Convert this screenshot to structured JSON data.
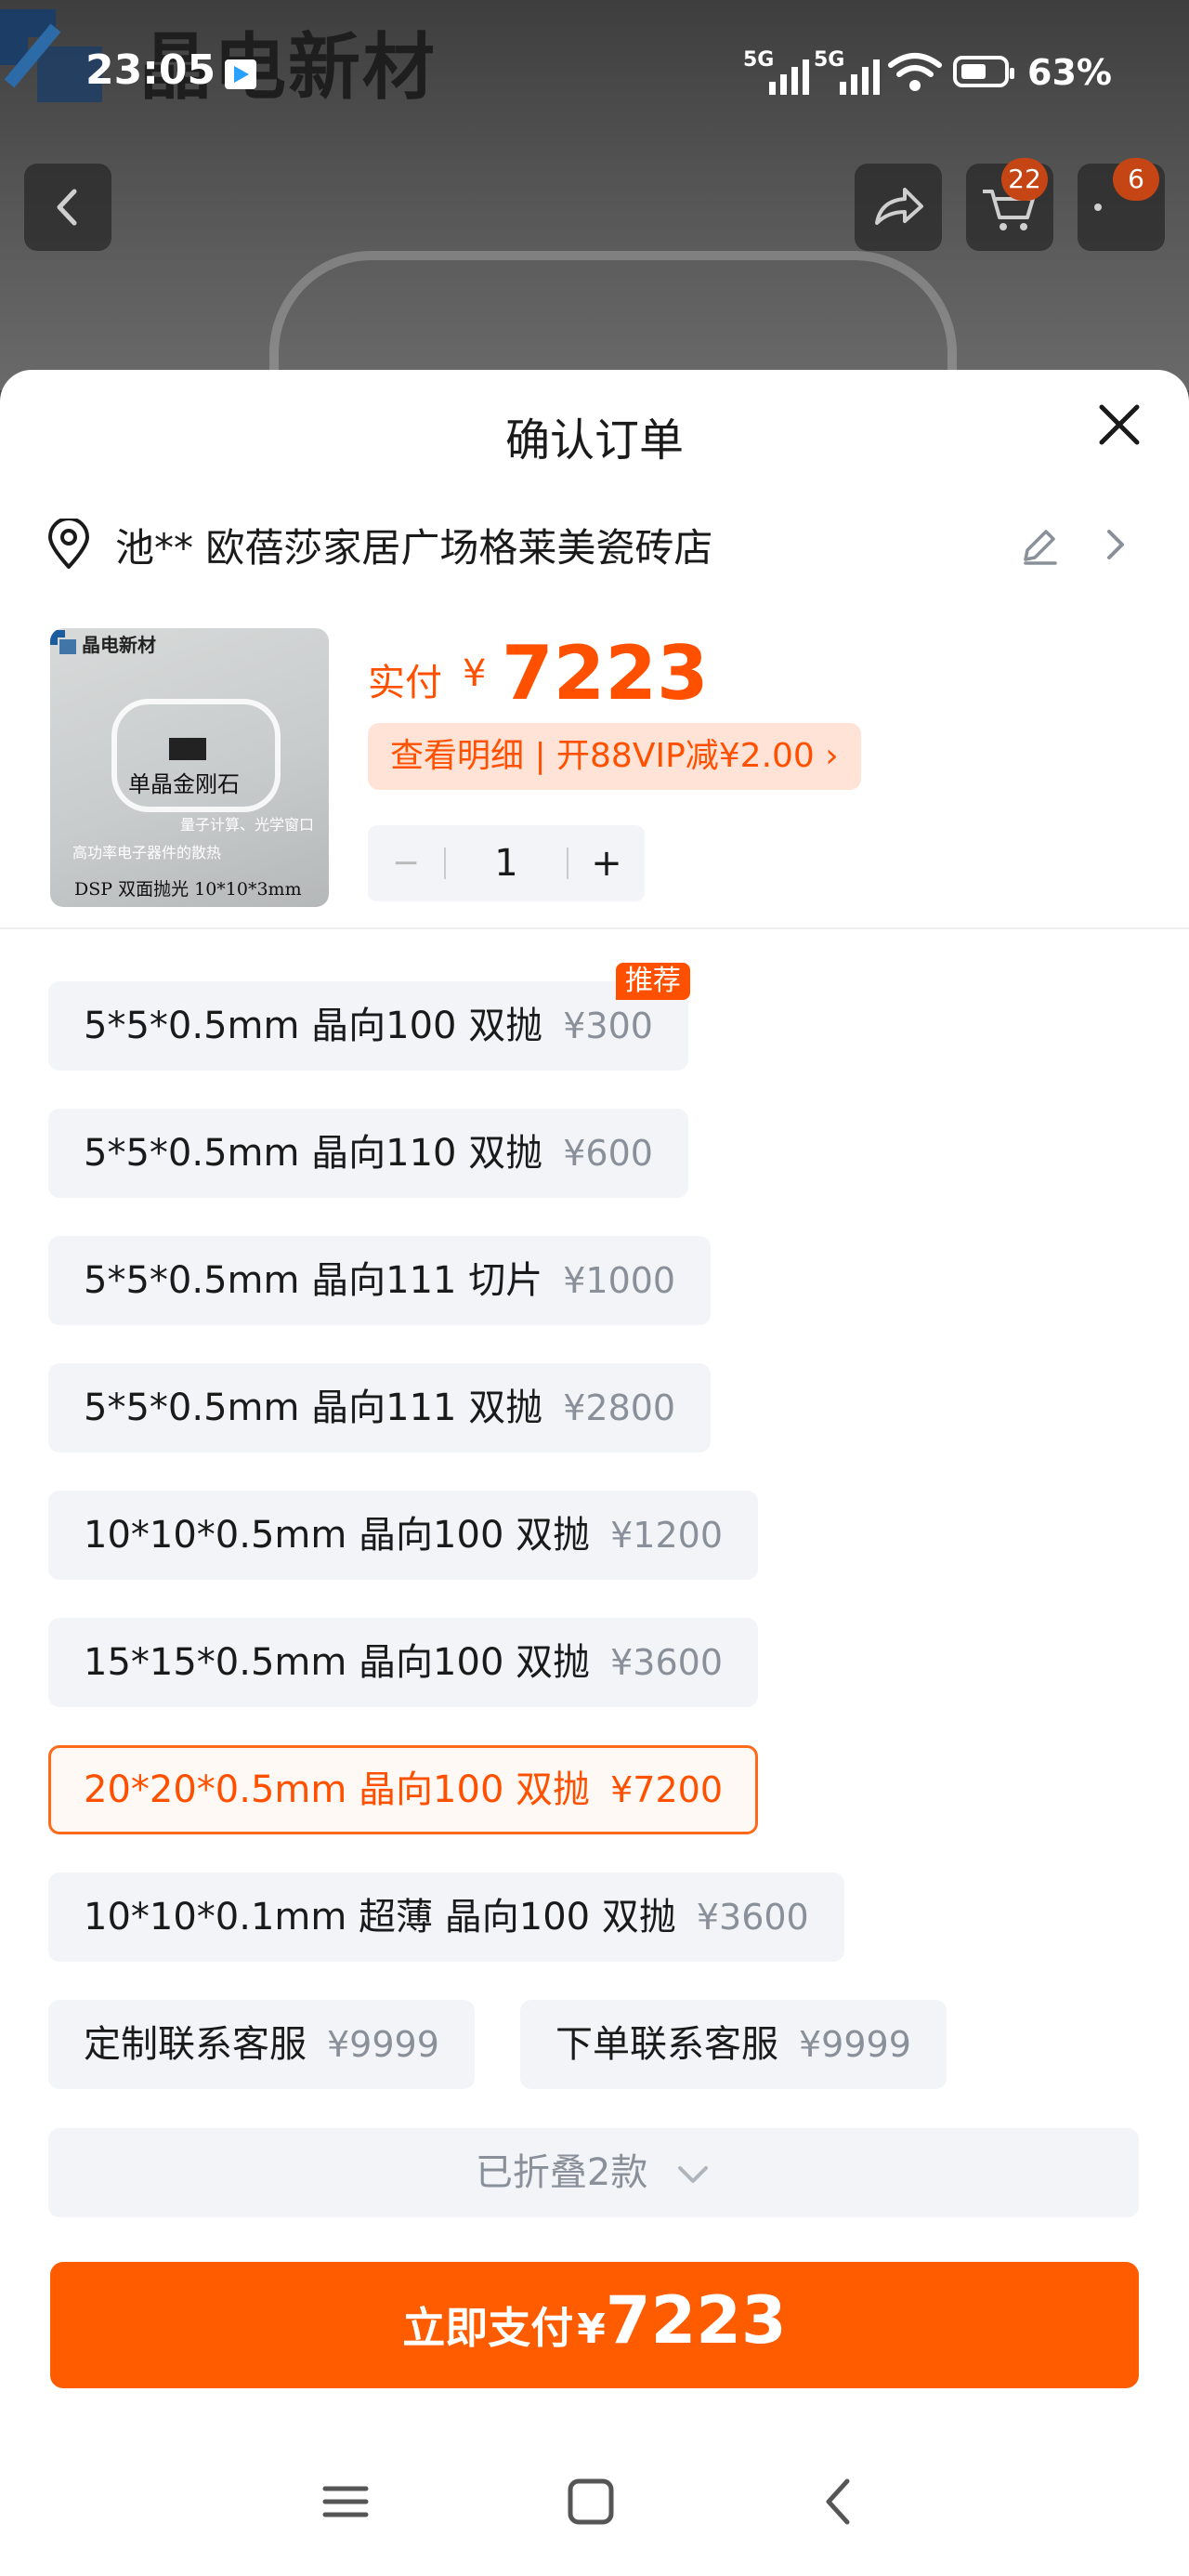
{
  "status_bar": {
    "time": "23:05",
    "sim1": "5G",
    "sim2": "5G",
    "battery_percent": "63%",
    "battery_level": 0.63
  },
  "background": {
    "brand_text": "晶电新材"
  },
  "top_buttons": {
    "cart_badge": "22",
    "more_badge": "6"
  },
  "sheet": {
    "title": "确认订单",
    "address": "池** 欧蓓莎家居广场格莱美瓷砖店"
  },
  "product": {
    "thumb_brand": "晶电新材",
    "thumb_name": "单晶金刚石",
    "thumb_line2": "量子计算、光学窗口",
    "thumb_line3": "高功率电子器件的散热",
    "thumb_line4": "DSP  双面抛光    10*10*3mm",
    "paid_label": "实付",
    "currency": "¥",
    "paid_amount": "7223",
    "detail_link": "查看明细 | 开88VIP减¥2.00 ›",
    "quantity": "1",
    "minus": "−",
    "plus": "+"
  },
  "options": [
    {
      "label": "5*5*0.5mm  晶向100 双抛",
      "price": "¥300",
      "tag": "推荐"
    },
    {
      "label": "5*5*0.5mm 晶向110 双抛",
      "price": "¥600"
    },
    {
      "label": "5*5*0.5mm  晶向111 切片",
      "price": "¥1000"
    },
    {
      "label": "5*5*0.5mm  晶向111 双抛",
      "price": "¥2800"
    },
    {
      "label": "10*10*0.5mm 晶向100 双抛",
      "price": "¥1200"
    },
    {
      "label": "15*15*0.5mm 晶向100 双抛",
      "price": "¥3600"
    },
    {
      "label": "20*20*0.5mm 晶向100 双抛",
      "price": "¥7200",
      "selected": true
    },
    {
      "label": "10*10*0.1mm 超薄 晶向100 双抛",
      "price": "¥3600"
    },
    {
      "label": "定制联系客服",
      "price": "¥9999"
    },
    {
      "label": "下单联系客服",
      "price": "¥9999"
    }
  ],
  "fold": {
    "label": "已折叠2款"
  },
  "pay_button": {
    "label": "立即支付",
    "currency": "¥",
    "amount": "7223"
  },
  "colors": {
    "accent": "#ff5000",
    "pay_button": "#ff5c00",
    "option_bg": "#f2f4f7"
  }
}
